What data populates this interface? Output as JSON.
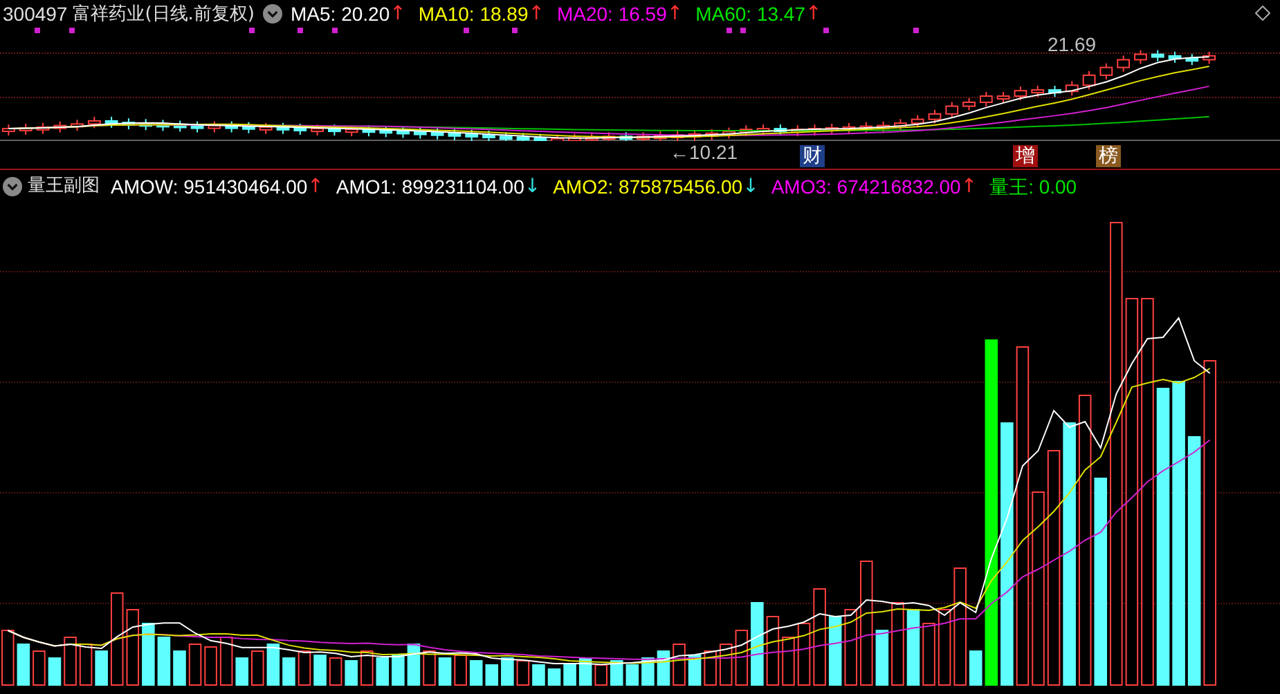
{
  "header": {
    "code": "300497",
    "title": "富祥药业(日线.前复权)",
    "indicators": [
      {
        "label": "MA5: 20.20",
        "color": "#ffffff",
        "arrow": "↑",
        "rising": true
      },
      {
        "label": "MA10: 18.89",
        "color": "#ffff00",
        "arrow": "↑",
        "rising": true
      },
      {
        "label": "MA20: 16.59",
        "color": "#ff00ff",
        "arrow": "↑",
        "rising": true
      },
      {
        "label": "MA60: 13.47",
        "color": "#00e600",
        "arrow": "↑",
        "rising": true
      }
    ]
  },
  "price_chart": {
    "high_label": "21.69",
    "low_label": "←10.21",
    "events": [
      {
        "label": "财",
        "color": "#1f3f8a"
      },
      {
        "label": "增",
        "color": "#a01010"
      },
      {
        "label": "榜",
        "color": "#8a5a20"
      }
    ]
  },
  "sub_chart": {
    "title": "量王副图",
    "indicators": [
      {
        "label": "AMOW: 951430464.00",
        "color": "#ffffff",
        "arrow": "↑",
        "rising": true
      },
      {
        "label": "AMO1: 899231104.00",
        "color": "#ffffff",
        "arrow": "↓",
        "rising": false
      },
      {
        "label": "AMO2: 875875456.00",
        "color": "#ffff00",
        "arrow": "↓",
        "rising": false
      },
      {
        "label": "AMO3: 674216832.00",
        "color": "#ff00ff",
        "arrow": "↑",
        "rising": true
      },
      {
        "label": "量王: 0.00",
        "color": "#00e600"
      }
    ]
  }
}
